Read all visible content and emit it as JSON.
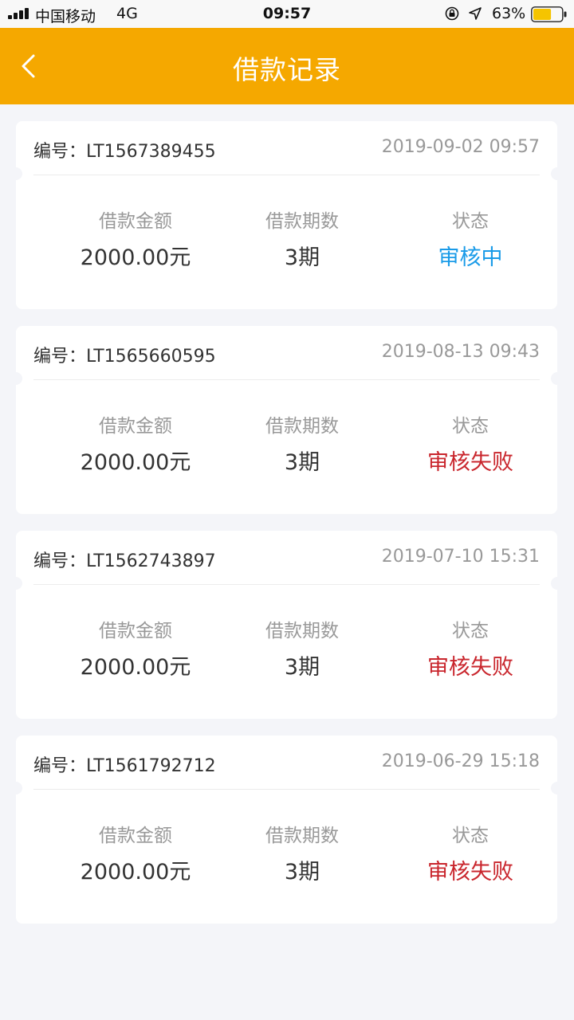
{
  "status_bar": {
    "carrier": "中国移动",
    "network": "4G",
    "time": "09:57",
    "battery_percent": "63%",
    "battery_level": 0.63
  },
  "nav": {
    "title": "借款记录",
    "back_icon": "chevron-left-icon"
  },
  "colors": {
    "accent": "#f5a800",
    "status_review": "#1a9be8",
    "status_failed": "#c9262d"
  },
  "records": [
    {
      "code": "编号：LT1567389455",
      "date": "2019-09-02 09:57",
      "amount_label": "借款金额",
      "amount": "2000.00元",
      "periods_label": "借款期数",
      "periods": "3期",
      "status_label": "状态",
      "status": "审核中",
      "status_type": "review"
    },
    {
      "code": "编号：LT1565660595",
      "date": "2019-08-13 09:43",
      "amount_label": "借款金额",
      "amount": "2000.00元",
      "periods_label": "借款期数",
      "periods": "3期",
      "status_label": "状态",
      "status": "审核失败",
      "status_type": "failed"
    },
    {
      "code": "编号：LT1562743897",
      "date": "2019-07-10 15:31",
      "amount_label": "借款金额",
      "amount": "2000.00元",
      "periods_label": "借款期数",
      "periods": "3期",
      "status_label": "状态",
      "status": "审核失败",
      "status_type": "failed"
    },
    {
      "code": "编号：LT1561792712",
      "date": "2019-06-29 15:18",
      "amount_label": "借款金额",
      "amount": "2000.00元",
      "periods_label": "借款期数",
      "periods": "3期",
      "status_label": "状态",
      "status": "审核失败",
      "status_type": "failed"
    }
  ]
}
